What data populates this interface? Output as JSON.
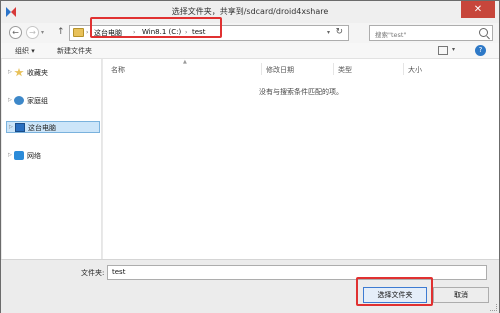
{
  "window": {
    "title": "选择文件夹，共享到/sdcard/droid4xshare",
    "close_glyph": "✕"
  },
  "address": {
    "segments": [
      "这台电脑",
      "Win8.1 (C:)",
      "test"
    ],
    "separator": "›",
    "search_placeholder": "搜索\"test\""
  },
  "toolbar": {
    "organize_label": "组织 ▾",
    "new_folder_label": "新建文件夹"
  },
  "sidebar": {
    "items": [
      {
        "label": "收藏夹",
        "icon": "star-icon"
      },
      {
        "label": "家庭组",
        "icon": "homegroup-icon"
      },
      {
        "label": "这台电脑",
        "icon": "computer-icon",
        "selected": true
      },
      {
        "label": "网络",
        "icon": "network-icon"
      }
    ]
  },
  "file_list": {
    "columns": [
      "名称",
      "修改日期",
      "类型",
      "大小"
    ],
    "empty_message": "没有与搜索条件匹配的项。"
  },
  "footer": {
    "folder_label": "文件夹:",
    "folder_value": "test",
    "select_button": "选择文件夹",
    "cancel_button": "取消"
  },
  "colors": {
    "highlight": "#e03131",
    "selection": "#cce5f9",
    "close_button": "#c7463b"
  }
}
